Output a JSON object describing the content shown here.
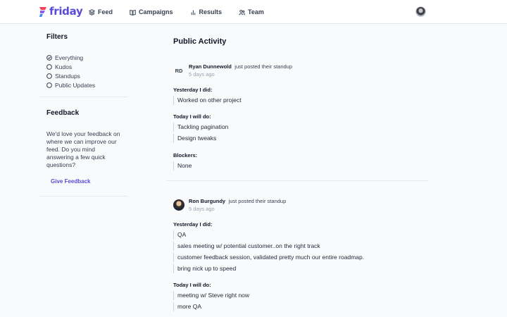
{
  "app": {
    "name": "friday",
    "brand_color": "#5b4bd6"
  },
  "nav": {
    "items": [
      {
        "label": "Feed",
        "icon": "layers-icon"
      },
      {
        "label": "Campaigns",
        "icon": "book-open-icon"
      },
      {
        "label": "Results",
        "icon": "bar-chart-icon"
      },
      {
        "label": "Team",
        "icon": "users-icon"
      }
    ]
  },
  "sidebar": {
    "filters_title": "Filters",
    "filters": [
      {
        "label": "Everything",
        "checked": true
      },
      {
        "label": "Kudos",
        "checked": false
      },
      {
        "label": "Standups",
        "checked": false
      },
      {
        "label": "Public Updates",
        "checked": false
      }
    ],
    "feedback_title": "Feedback",
    "feedback_text": "We'd love your feedback on where we can improve our feed. Do you mind answering a few quick questions?",
    "feedback_link": "Give Feedback"
  },
  "main": {
    "title": "Public Activity",
    "posts": [
      {
        "initials": "RD",
        "author": "Ryan Dunnewold",
        "action": "just posted their standup",
        "time": "5 days ago",
        "yesterday_label": "Yesterday I did:",
        "yesterday": [
          "Worked on other project"
        ],
        "today_label": "Today I will do:",
        "today": [
          "Tackling pagination",
          "Design tweaks"
        ],
        "blockers_label": "Blockers:",
        "blockers": [
          "None"
        ]
      },
      {
        "author": "Ron Burgundy",
        "action": "just posted their standup",
        "time": "5 days ago",
        "yesterday_label": "Yesterday I did:",
        "yesterday": [
          "QA",
          "sales meeting w/ potential customer..on the right track",
          "customer feedback session, validated pretty much our entire roadmap.",
          "bring nick up to speed"
        ],
        "today_label": "Today I will do:",
        "today": [
          "meeting w/ Steve right now",
          "more QA"
        ]
      }
    ]
  }
}
